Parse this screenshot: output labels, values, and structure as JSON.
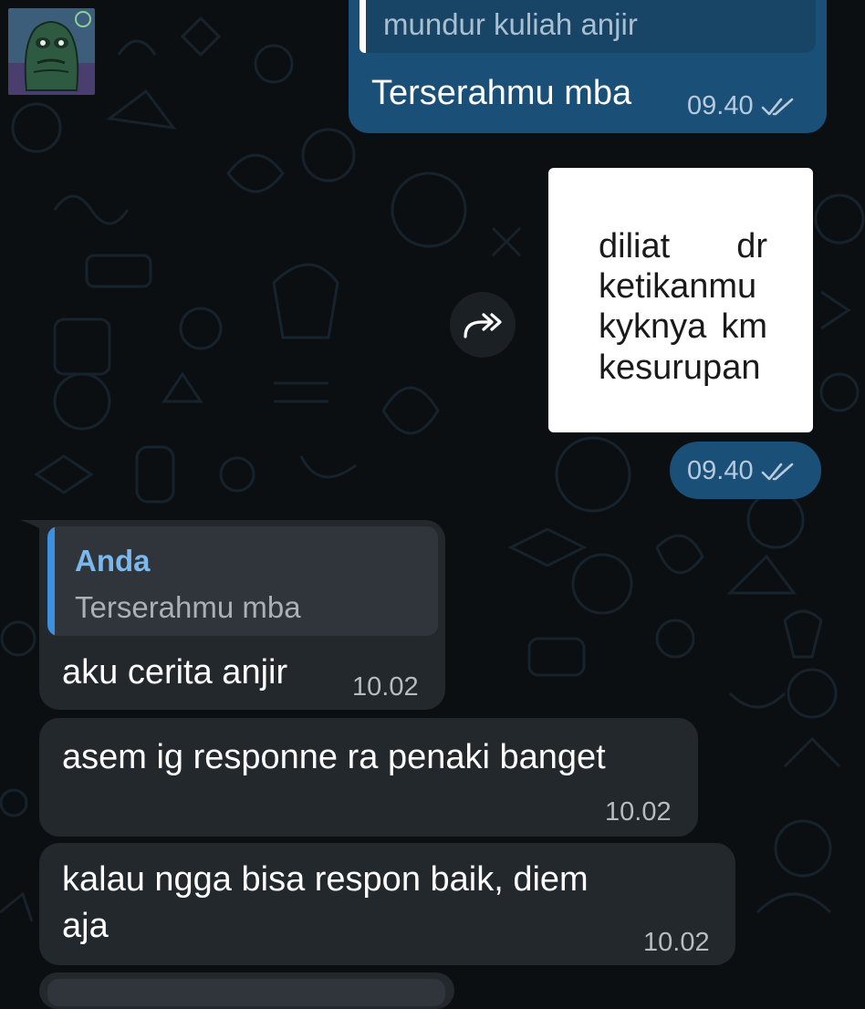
{
  "theme": {
    "background": "#0b0f12",
    "outgoing_bubble": "#1a4f78",
    "incoming_bubble": "#23282d",
    "quote_accent": "#3d8fe0",
    "quote_name_color": "#7ab8ee"
  },
  "avatar": {
    "icon": "fish-avatar-icon"
  },
  "messages": [
    {
      "direction": "outgoing",
      "reply_to_text": "mundur kuliah anjir",
      "text": "Terserahmu mba",
      "time": "09.40",
      "status_icon": "double-check-icon"
    },
    {
      "direction": "outgoing",
      "type": "sticker",
      "sticker_lines": [
        "diliat",
        "dr",
        "ketikanmu",
        "kyknya",
        "km",
        "kesurupan"
      ],
      "time": "09.40",
      "status_icon": "double-check-icon",
      "forward_icon": "forward-icon"
    },
    {
      "direction": "incoming",
      "reply_name": "Anda",
      "reply_to_text": "Terserahmu mba",
      "text": "aku cerita anjir",
      "time": "10.02"
    },
    {
      "direction": "incoming",
      "text": "asem ig responne ra penaki banget",
      "time": "10.02"
    },
    {
      "direction": "incoming",
      "text_line_1": "kalau ngga bisa respon baik, diem",
      "text_line_2": "aja",
      "time": "10.02"
    }
  ]
}
